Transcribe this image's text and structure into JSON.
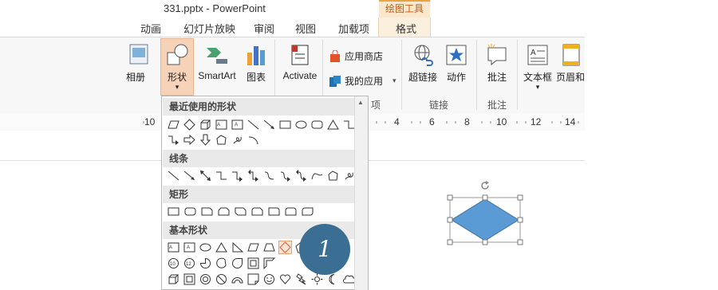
{
  "window": {
    "title": "331.pptx - PowerPoint"
  },
  "context_tab_group": "绘图工具",
  "tabs": [
    "动画",
    "幻灯片放映",
    "审阅",
    "视图",
    "加载项",
    "格式"
  ],
  "ribbon": {
    "album_label": "相册",
    "shapes_label": "形状",
    "smartart_label": "SmartArt",
    "chart_label": "图表",
    "activate_label": "Activate",
    "store_label": "应用商店",
    "myapps_label": "我的应用",
    "hyperlink_label": "超链接",
    "action_label": "动作",
    "comment_label": "批注",
    "textbox_label": "文本框",
    "headerfooter_label": "页眉和",
    "group_apps": "项",
    "group_links": "链接",
    "group_comments": "批注"
  },
  "ruler": {
    "ticks": [
      "10",
      "4",
      "6",
      "8",
      "10",
      "12",
      "14"
    ]
  },
  "gallery": {
    "sections": [
      "最近使用的形状",
      "线条",
      "矩形",
      "基本形状"
    ],
    "badge": "1"
  },
  "colors": {
    "accent_orange": "#e6a540",
    "shape_blue": "#5b9bd5",
    "badge_blue": "#3a6f93"
  }
}
